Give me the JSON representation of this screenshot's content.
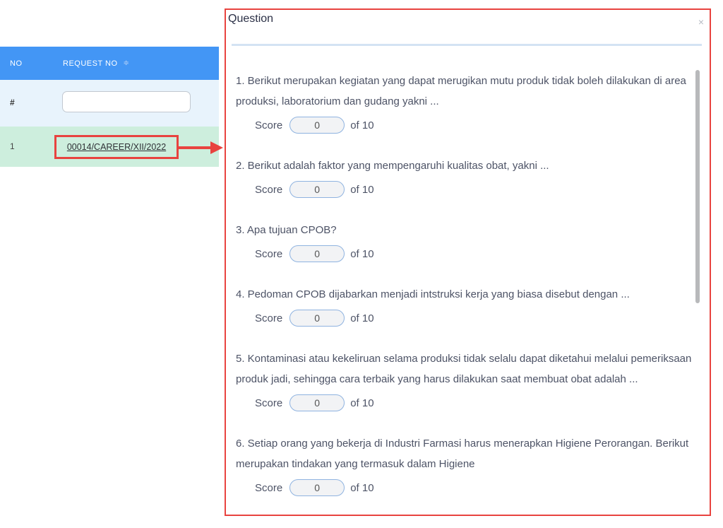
{
  "table": {
    "headers": {
      "no": "NO",
      "request_no": "REQUEST NO"
    },
    "sort_icon": "≑",
    "filter": {
      "no": "#",
      "request_no_value": ""
    },
    "rows": [
      {
        "no": "1",
        "request_no": "00014/CAREER/XII/2022"
      }
    ]
  },
  "modal": {
    "title": "Question",
    "close": "×",
    "score_label": "Score",
    "questions": [
      {
        "text": "1. Berikut merupakan kegiatan yang dapat merugikan mutu produk tidak boleh dilakukan di area produksi, laboratorium dan gudang yakni ...",
        "score": "0",
        "of": "of 10"
      },
      {
        "text": "2. Berikut adalah faktor yang mempengaruhi kualitas obat, yakni ...",
        "score": "0",
        "of": "of 10"
      },
      {
        "text": "3. Apa tujuan CPOB?",
        "score": "0",
        "of": "of 10"
      },
      {
        "text": "4. Pedoman CPOB dijabarkan menjadi intstruksi kerja yang biasa disebut dengan ...",
        "score": "0",
        "of": "of 10"
      },
      {
        "text": "5. Kontaminasi atau kekeliruan selama produksi tidak selalu dapat diketahui melalui pemeriksaan produk jadi, sehingga cara terbaik yang harus dilakukan saat membuat obat adalah ...",
        "score": "0",
        "of": "of 10"
      },
      {
        "text": "6. Setiap orang yang bekerja di Industri Farmasi harus menerapkan Higiene Perorangan. Berikut merupakan tindakan yang termasuk dalam Higiene",
        "score": "0",
        "of": "of 10"
      }
    ]
  },
  "colors": {
    "header_blue": "#4396f5",
    "highlight_red": "#e8433f",
    "row_green": "#cdeedd",
    "filter_row_blue": "#e8f3fc"
  }
}
